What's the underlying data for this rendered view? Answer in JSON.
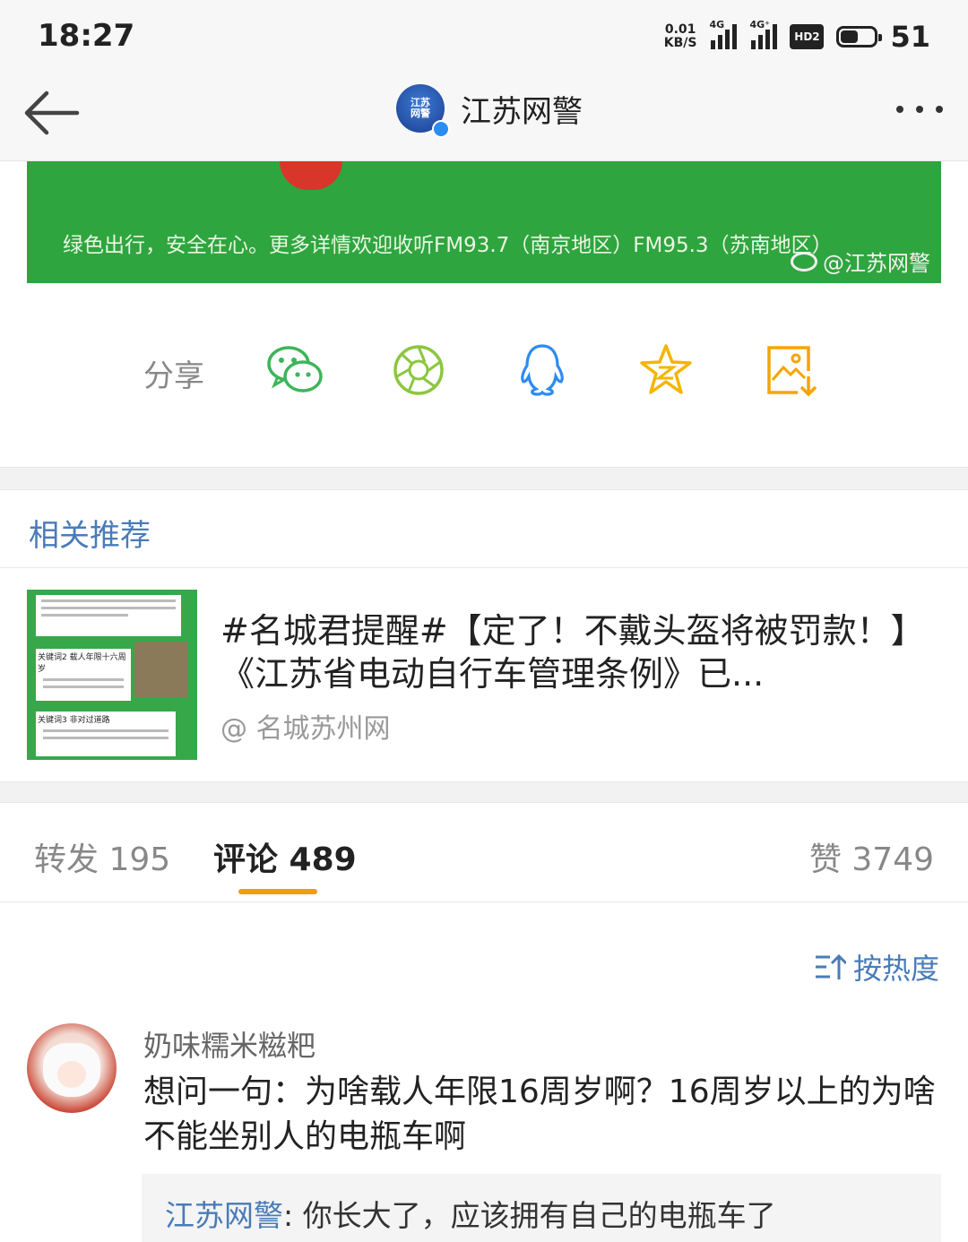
{
  "status_bar": {
    "time": "18:27",
    "net_speed_value": "0.01",
    "net_speed_unit": "KB/S",
    "signal1_tag": "4G",
    "signal2_tag": "4G⁺",
    "hd_badge": "HD2",
    "battery_percent": "51",
    "battery_level": 0.51
  },
  "nav": {
    "title": "江苏网警",
    "logo_text_line1": "江苏",
    "logo_text_line2": "网警"
  },
  "banner": {
    "caption": "绿色出行，安全在心。更多详情欢迎收听FM93.7（南京地区）FM95.3（苏南地区）",
    "watermark": "@江苏网警",
    "accent_color": "#2fa53f"
  },
  "share": {
    "label": "分享",
    "targets": [
      {
        "icon": "wechat-icon"
      },
      {
        "icon": "moments-icon"
      },
      {
        "icon": "qq-icon"
      },
      {
        "icon": "qzone-icon"
      },
      {
        "icon": "save-image-icon"
      }
    ]
  },
  "related": {
    "header": "相关推荐",
    "item": {
      "text": "#名城君提醒#【定了！不戴头盔将被罚款！】《江苏省电动自行车管理条例》已...",
      "source": "@ 名城苏州网",
      "thumb_label1": "关键词2 载人年限十六周岁",
      "thumb_label2": "关键词3 非对过道路"
    }
  },
  "tabs": {
    "repost": "转发 195",
    "comments": "评论 489",
    "likes": "赞 3749",
    "active_color": "#f39c12"
  },
  "sort": {
    "label": "按热度"
  },
  "comment": {
    "author": "奶味糯米糍粑",
    "text": "想问一句：为啥载人年限16周岁啊？16周岁以上的为啥不能坐别人的电瓶车啊",
    "reply": {
      "author": "江苏网警",
      "separator": ": ",
      "text": "你长大了，应该拥有自己的电瓶车了"
    }
  },
  "colors": {
    "link_blue": "#4a7bb8"
  }
}
